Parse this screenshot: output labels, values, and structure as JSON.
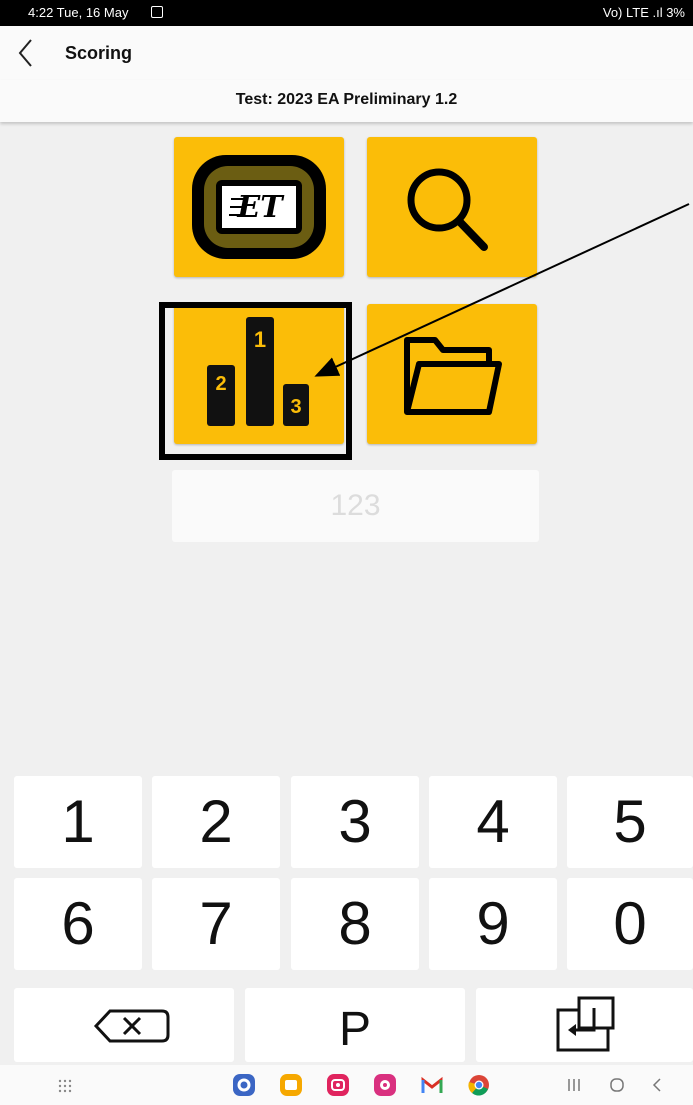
{
  "status_bar": {
    "time_date": "4:22  Tue, 16 May",
    "right_indicators": " Vo) LTE .ıl 3%"
  },
  "app_bar": {
    "title": "Scoring"
  },
  "test_header": "Test: 2023 EA Preliminary 1.2",
  "tiles": [
    {
      "name": "device",
      "logo_text": "ET"
    },
    {
      "name": "search"
    },
    {
      "name": "results",
      "podium": [
        "2",
        "1",
        "3"
      ]
    },
    {
      "name": "folder"
    }
  ],
  "code_input": {
    "placeholder": "123",
    "value": ""
  },
  "keypad": {
    "row1": [
      "1",
      "2",
      "3",
      "4",
      "5"
    ],
    "row2": [
      "6",
      "7",
      "8",
      "9",
      "0"
    ],
    "row3": [
      "backspace",
      "P",
      "enter"
    ]
  },
  "colors": {
    "accent": "#fbbd08",
    "background": "#f0f0f0",
    "key_bg": "#ffffff"
  },
  "nav_bar": {
    "dock_apps": [
      "settings",
      "my-files",
      "camera",
      "gallery",
      "gmail",
      "chrome"
    ],
    "nav_buttons": [
      "recents",
      "home",
      "back"
    ]
  }
}
